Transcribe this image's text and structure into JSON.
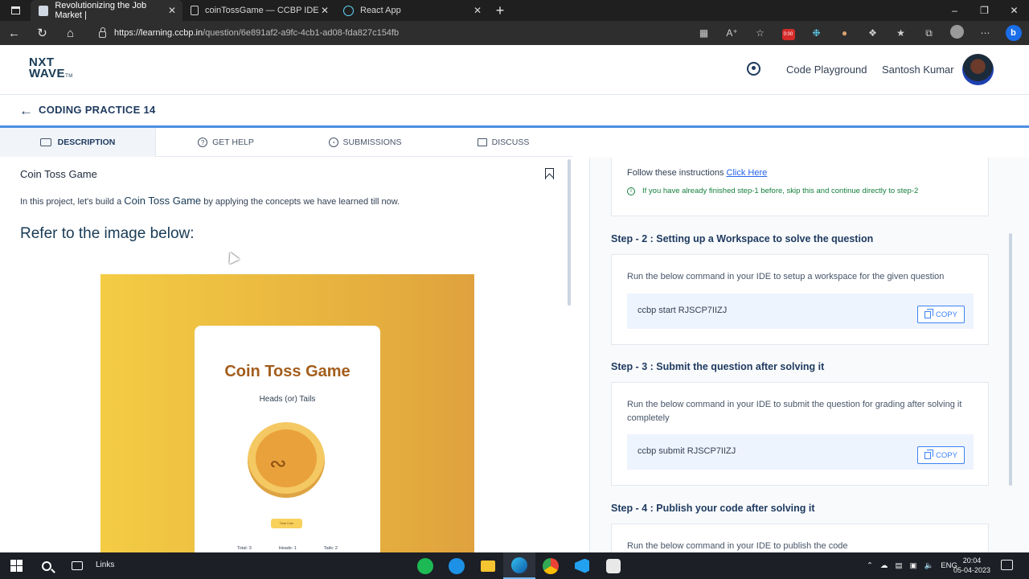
{
  "browser": {
    "tabs": [
      {
        "title": "Revolutionizing the Job Market |"
      },
      {
        "title": "coinTossGame — CCBP IDE"
      },
      {
        "title": "React App"
      }
    ],
    "close_glyph": "✕",
    "new_tab_glyph": "+",
    "url_host": "https://learning.ccbp.in",
    "url_path": "/question/6e891af2-a9fc-4cb1-ad08-fda827c154fb",
    "recording_badge": "0:00",
    "icons": [
      "tab-list-icon",
      "back-icon",
      "reload-icon",
      "home-icon",
      "lock-icon",
      "reading-view-icon",
      "read-aloud-icon",
      "favorite-icon",
      "extensions-icon",
      "favorites-icon",
      "collections-icon",
      "profile-icon",
      "more-icon",
      "bing-icon"
    ]
  },
  "header": {
    "logo_line1": "NXT",
    "logo_line2": "WAVE",
    "logo_tm": "TM",
    "code_playground": "Code Playground",
    "user_name": "Santosh Kumar"
  },
  "page": {
    "back_arrow": "←",
    "title": "CODING PRACTICE 14"
  },
  "tabs": [
    {
      "label": "DESCRIPTION",
      "active": true
    },
    {
      "label": "GET HELP"
    },
    {
      "label": "SUBMISSIONS"
    },
    {
      "label": "DISCUSS"
    }
  ],
  "description": {
    "question_title": "Coin Toss Game",
    "intro_before": "In this project, let's build a ",
    "intro_highlight": "Coin Toss Game",
    "intro_after": " by applying the concepts we have learned till now.",
    "refer_heading": "Refer to the image below:",
    "preview": {
      "title": "Coin Toss Game",
      "subtitle": "Heads (or) Tails",
      "button": "Toss Coin",
      "stat_total": "Total: 3",
      "stat_heads": "Heads: 1",
      "stat_tails": "Tails: 2"
    }
  },
  "steps": {
    "step1_instructions": "Follow these instructions ",
    "step1_link": "Click Here",
    "step1_note": "If you have already finished step-1 before, skip this and continue directly to step-2",
    "step2_heading": "Step - 2 : Setting up a Workspace to solve the question",
    "step2_text": "Run the below command in your IDE to setup a workspace for the given question",
    "step2_command": "ccbp start RJSCP7IIZJ",
    "step3_heading": "Step - 3 : Submit the question after solving it",
    "step3_text": "Run the below command in your IDE to submit the question for grading after solving it completely",
    "step3_command": "ccbp submit RJSCP7IIZJ",
    "step4_heading": "Step - 4 : Publish your code after solving it",
    "step4_text": "Run the below command in your IDE to publish the code",
    "copy_label": "COPY"
  },
  "taskbar": {
    "links_label": "Links",
    "tray_language": "ENG",
    "time": "20:04",
    "date": "05-04-2023"
  }
}
